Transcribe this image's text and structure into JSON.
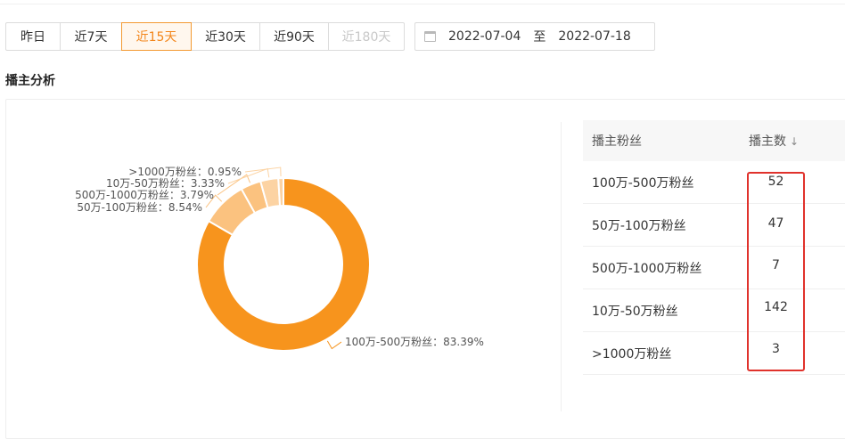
{
  "filters": {
    "ranges": [
      {
        "label": "昨日",
        "state": "normal"
      },
      {
        "label": "近7天",
        "state": "normal"
      },
      {
        "label": "近15天",
        "state": "active"
      },
      {
        "label": "近30天",
        "state": "normal"
      },
      {
        "label": "近90天",
        "state": "normal"
      },
      {
        "label": "近180天",
        "state": "disabled"
      }
    ],
    "date_range": {
      "start": "2022-07-04",
      "separator": "至",
      "end": "2022-07-18"
    },
    "calendar_icon": "calendar-icon"
  },
  "section_title": "播主分析",
  "colors": {
    "accent": "#f3861b",
    "slice_main": "#f7941d",
    "slice_light": "#fbc27f",
    "slice_lighter": "#fcd3a3",
    "highlight": "#e0322c"
  },
  "chart_data": {
    "type": "pie",
    "donut": true,
    "slices": [
      {
        "label": "100万-500万粉丝",
        "value": 83.39
      },
      {
        "label": "50万-100万粉丝",
        "value": 8.54
      },
      {
        "label": "500万-1000万粉丝",
        "value": 3.79
      },
      {
        "label": "10万-50万粉丝",
        "value": 3.33
      },
      {
        "label": ">1000万粉丝",
        "value": 0.95
      }
    ],
    "label_format": "{label}：{value}%"
  },
  "table": {
    "headers": {
      "name": "播主粉丝",
      "count": "播主数",
      "sort_icon": "sort-desc-icon"
    },
    "rows": [
      {
        "name": "100万-500万粉丝",
        "count": "52"
      },
      {
        "name": "50万-100万粉丝",
        "count": "47"
      },
      {
        "name": "500万-1000万粉丝",
        "count": "7"
      },
      {
        "name": "10万-50万粉丝",
        "count": "142"
      },
      {
        "name": ">1000万粉丝",
        "count": "3"
      }
    ]
  }
}
